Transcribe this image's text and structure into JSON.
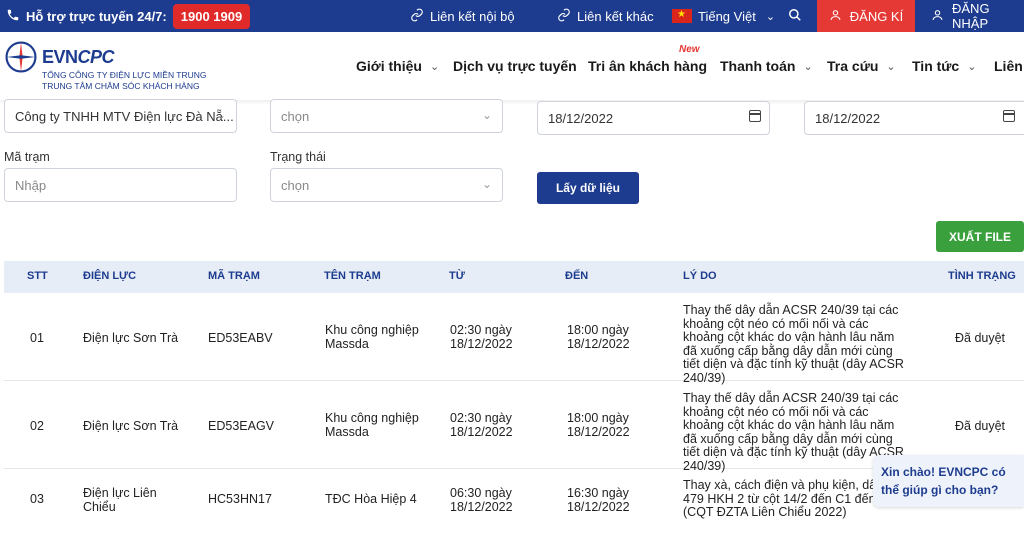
{
  "topbar": {
    "support_label": "Hỗ trợ trực tuyến 24/7:",
    "hotline": "1900 1909",
    "internal_links": "Liên kết nội bộ",
    "other_links": "Liên kết khác",
    "language": "Tiếng Việt",
    "register": "ĐĂNG KÍ",
    "login": "ĐĂNG NHẬP"
  },
  "logo": {
    "brand_main": "EVN",
    "brand_accent": "CPC",
    "line1": "TỔNG CÔNG TY ĐIỆN LỰC MIỀN TRUNG",
    "line2": "TRUNG TÂM CHĂM SÓC KHÁCH HÀNG"
  },
  "nav": {
    "items": [
      {
        "label": "Giới thiệu"
      },
      {
        "label": "Dịch vụ trực tuyến"
      },
      {
        "label": "Tri ân khách hàng",
        "badge": "New"
      },
      {
        "label": "Thanh toán"
      },
      {
        "label": "Tra cứu"
      },
      {
        "label": "Tin tức"
      },
      {
        "label": "Liên h"
      }
    ]
  },
  "filters": {
    "company_value": "Công ty TNHH MTV Điện lực Đà Nẵ...",
    "dropdown2_placeholder": "chọn",
    "from_date": "18/12/2022",
    "to_date": "18/12/2022",
    "station_code_label": "Mã trạm",
    "station_code_placeholder": "Nhập",
    "status_label": "Trạng thái",
    "status_placeholder": "chọn",
    "fetch_button": "Lấy dữ liệu",
    "export_button": "XUẤT FILE"
  },
  "table": {
    "headers": [
      "STT",
      "ĐIỆN LỰC",
      "MÃ TRẠM",
      "TÊN TRẠM",
      "TỪ",
      "ĐẾN",
      "LÝ DO",
      "TÌNH TRẠNG"
    ],
    "rows": [
      {
        "stt": "01",
        "dien_luc": "Điện lực Sơn Trà",
        "ma_tram": "ED53EABV",
        "ten_tram": "Khu công nghiệp Massda",
        "tu": "02:30 ngày 18/12/2022",
        "den": "18:00 ngày 18/12/2022",
        "ly_do": "Thay thế dây dẫn ACSR 240/39 tại các khoảng cột néo có mối nối và các khoảng cột khác do vận hành lâu năm đã xuống cấp bằng dây dẫn mới cùng tiết diện và đặc tính kỹ thuật (dây ACSR 240/39)",
        "tinh_trang": "Đã duyệt"
      },
      {
        "stt": "02",
        "dien_luc": "Điện lực Sơn Trà",
        "ma_tram": "ED53EAGV",
        "ten_tram": "Khu công nghiệp Massda",
        "tu": "02:30 ngày 18/12/2022",
        "den": "18:00 ngày 18/12/2022",
        "ly_do": "Thay thế dây dẫn ACSR 240/39 tại các khoảng cột néo có mối nối và các khoảng cột khác do vận hành lâu năm đã xuống cấp bằng dây dẫn mới cùng tiết diện và đặc tính kỹ thuật (dây ACSR 240/39)",
        "tinh_trang": "Đã duyệt"
      },
      {
        "stt": "03",
        "dien_luc": "Điện lực Liên Chiểu",
        "ma_tram": "HC53HN17",
        "ten_tram": "TĐC Hòa Hiệp 4",
        "tu": "06:30 ngày 18/12/2022",
        "den": "16:30 ngày 18/12/2022",
        "ly_do": "Thay xà, cách điện và phụ kiện, dây c 479 HKH 2 từ cột 14/2 đến C1 đến C (CQT ĐZTA Liên Chiểu 2022)",
        "tinh_trang": ""
      }
    ]
  },
  "chat": {
    "message": "Xin chào! EVNCPC có thể giúp gì cho bạn?"
  }
}
